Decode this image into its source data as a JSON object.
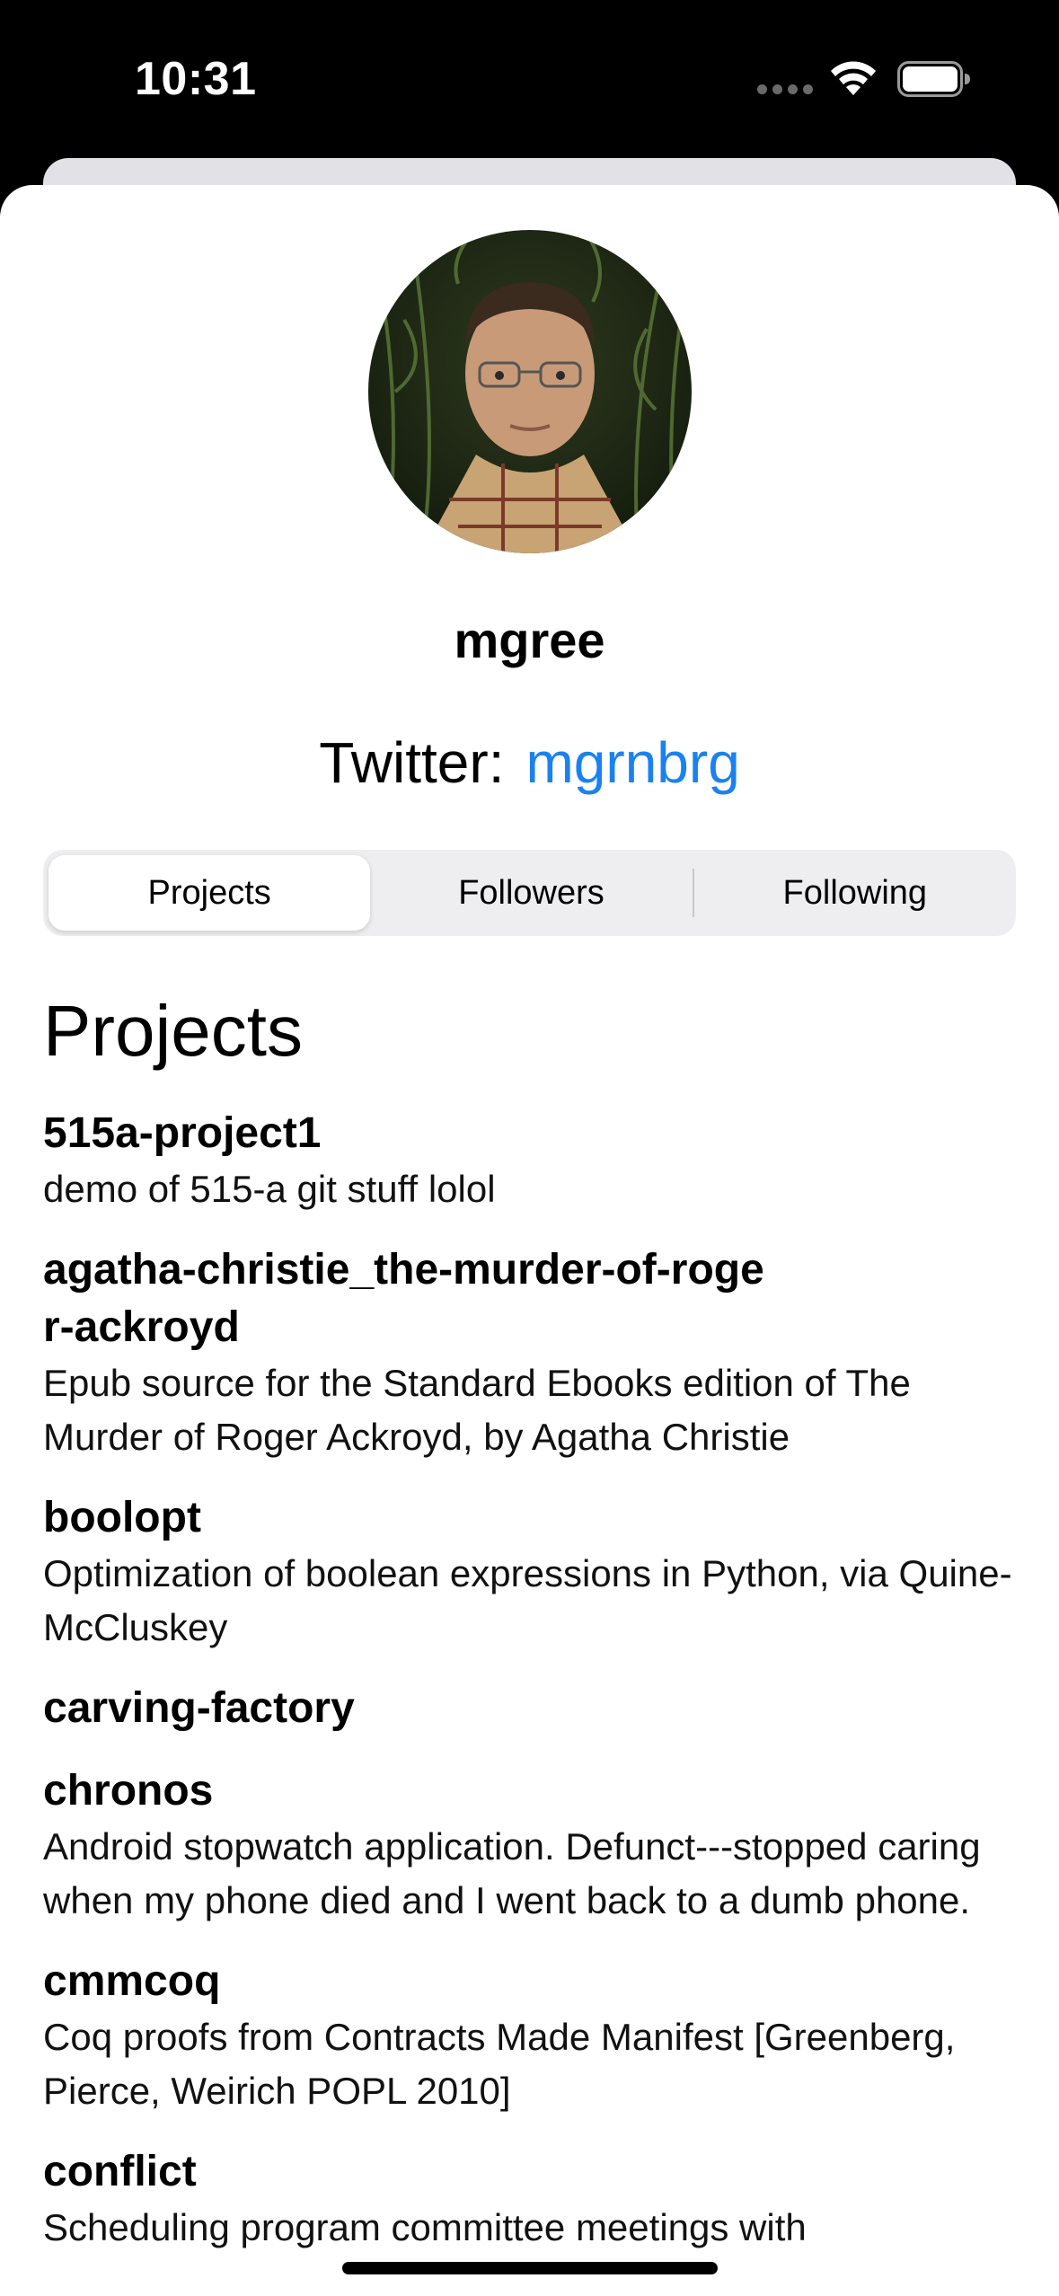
{
  "status_bar": {
    "time": "10:31"
  },
  "profile": {
    "username": "mgree",
    "twitter_label": "Twitter:",
    "twitter_handle": "mgrnbrg"
  },
  "tabs": [
    {
      "label": "Projects",
      "selected": true
    },
    {
      "label": "Followers",
      "selected": false
    },
    {
      "label": "Following",
      "selected": false
    }
  ],
  "section_title": "Projects",
  "projects": [
    {
      "name": "515a-project1",
      "description": "demo of 515-a git stuff lolol"
    },
    {
      "name": "agatha-christie_the-murder-of-roger-ackroyd",
      "description": "Epub source for the Standard Ebooks edition of The Murder of Roger Ackroyd, by Agatha Christie"
    },
    {
      "name": "boolopt",
      "description": "Optimization of boolean expressions in Python, via Quine-McCluskey"
    },
    {
      "name": "carving-factory",
      "description": ""
    },
    {
      "name": "chronos",
      "description": "Android stopwatch application. Defunct---stopped caring when my phone died and I went back to a dumb phone."
    },
    {
      "name": "cmmcoq",
      "description": "Coq proofs from Contracts Made Manifest [Greenberg, Pierce, Weirich POPL 2010]"
    },
    {
      "name": "conflict",
      "description": "Scheduling program committee meetings with"
    }
  ],
  "colors": {
    "link": "#1a82f0",
    "segment_bg": "#eeeef0"
  }
}
